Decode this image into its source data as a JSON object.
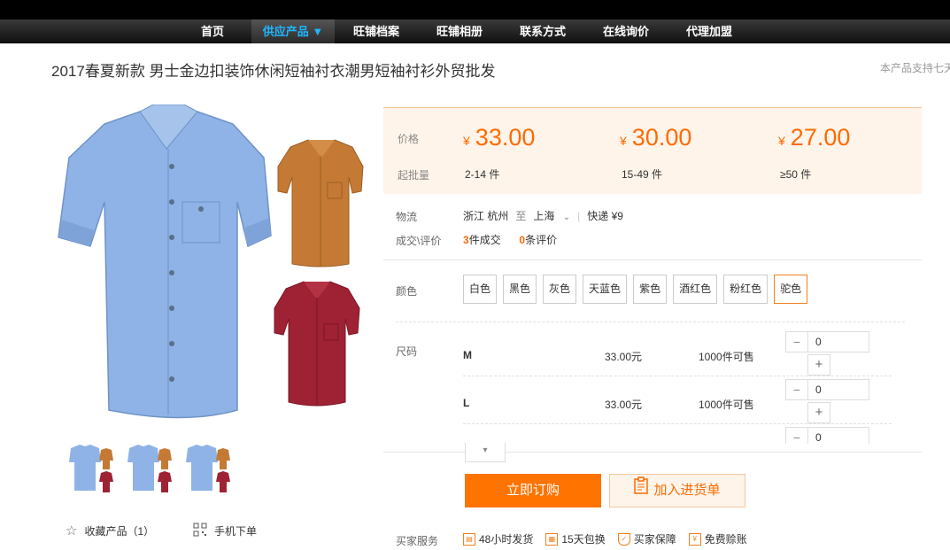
{
  "nav": {
    "items": [
      {
        "label": "首页"
      },
      {
        "label": "供应产品 ▼"
      },
      {
        "label": "旺铺档案"
      },
      {
        "label": "旺铺相册"
      },
      {
        "label": "联系方式"
      },
      {
        "label": "在线询价"
      },
      {
        "label": "代理加盟"
      }
    ],
    "active_index": 1
  },
  "product": {
    "title": "2017春夏新款 男士金边扣装饰休闲短袖衬衣潮男短袖衬衫外贸批发",
    "support_text": "本产品支持七天",
    "image_colors": {
      "main": "#8fb3e6",
      "orange": "#c47a35",
      "red": "#9e2233"
    }
  },
  "pricing": {
    "price_label": "价格",
    "moq_label": "起批量",
    "currency": "¥",
    "tiers": [
      {
        "price": "33.00",
        "moq": "2-14 件"
      },
      {
        "price": "30.00",
        "moq": "15-49 件"
      },
      {
        "price": "27.00",
        "moq": "≥50 件"
      }
    ],
    "accent_color": "#ff6a00"
  },
  "logistics": {
    "label": "物流",
    "from": "浙江 杭州",
    "to_word": "至",
    "to": "上海",
    "shipping": "快递 ¥9"
  },
  "deals": {
    "label": "成交\\评价",
    "count": "3",
    "count_suffix": "件成交",
    "reviews": "0",
    "reviews_suffix": "条评价"
  },
  "colors": {
    "label": "颜色",
    "options": [
      "白色",
      "黑色",
      "灰色",
      "天蓝色",
      "紫色",
      "酒红色",
      "粉红色",
      "驼色"
    ],
    "selected": "驼色"
  },
  "sizes": {
    "label": "尺码",
    "rows": [
      {
        "name": "M",
        "price": "33.00元",
        "stock": "1000件可售",
        "qty": "0"
      },
      {
        "name": "L",
        "price": "33.00元",
        "stock": "1000件可售",
        "qty": "0"
      },
      {
        "name": "",
        "price": "",
        "stock": "",
        "qty": "0"
      }
    ],
    "minus": "−",
    "plus": "+"
  },
  "actions": {
    "buy_label": "立即订购",
    "cart_label": "加入进货单"
  },
  "gallery": {
    "favorite_label": "收藏产品（1）",
    "mobile_label": "手机下单"
  },
  "services": {
    "label": "买家服务",
    "items": [
      {
        "label": "48小时发货",
        "icon": "truck-icon"
      },
      {
        "label": "15天包换",
        "icon": "calendar-icon"
      },
      {
        "label": "买家保障",
        "icon": "shield-icon"
      },
      {
        "label": "免费赊账",
        "icon": "coin-icon"
      }
    ]
  }
}
